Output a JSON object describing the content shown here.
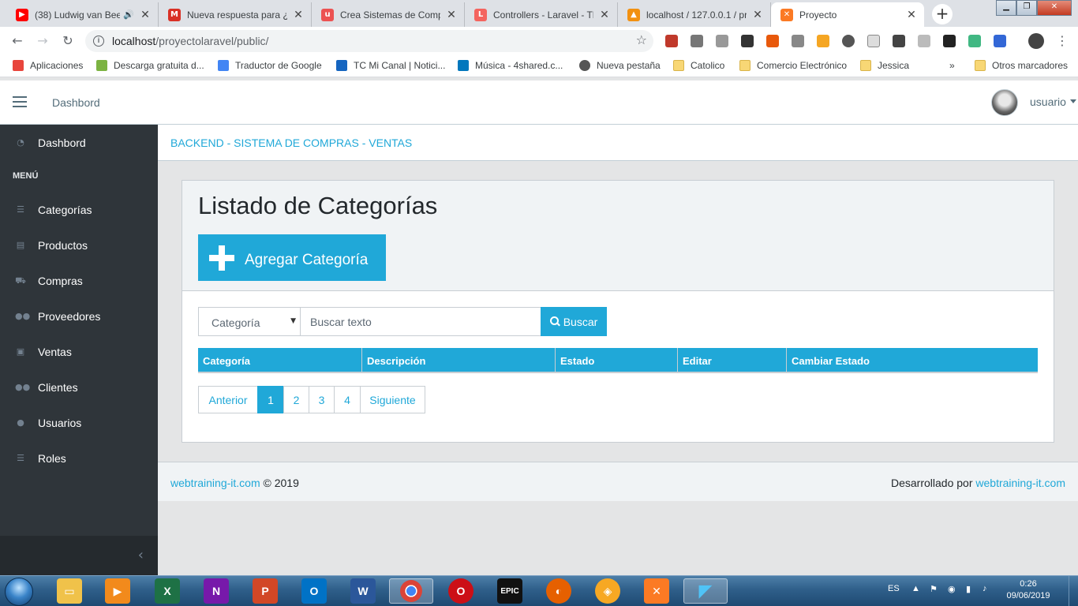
{
  "browser": {
    "tabs": [
      {
        "title": "(38) Ludwig van Bee",
        "fav": "youtube-icon",
        "color": "#ff0000",
        "glyph": "▶"
      },
      {
        "title": "Nueva respuesta para ¿C",
        "fav": "gmail-icon",
        "color": "#d93025",
        "glyph": "M"
      },
      {
        "title": "Crea Sistemas de Compr",
        "fav": "udemy-icon",
        "color": "#ec5252",
        "glyph": "u"
      },
      {
        "title": "Controllers - Laravel - Th",
        "fav": "laravel-icon",
        "color": "#f4645f",
        "glyph": "L"
      },
      {
        "title": "localhost / 127.0.0.1 / pr",
        "fav": "phpmyadmin-icon",
        "color": "#f29111",
        "glyph": "▲"
      },
      {
        "title": "Proyecto",
        "fav": "xampp-icon",
        "color": "#fb7a24",
        "glyph": "✕"
      }
    ],
    "address": {
      "host": "localhost",
      "path": "/proyectolaravel/public/"
    },
    "bookmarks": [
      {
        "label": "Aplicaciones",
        "icon": "apps-grid-icon",
        "folder": false,
        "color": "#e8453c"
      },
      {
        "label": "Descarga gratuita d...",
        "icon": "download-icon",
        "folder": false,
        "color": "#7cb342"
      },
      {
        "label": "Traductor de Google",
        "icon": "google-translate-icon",
        "folder": false,
        "color": "#4285f4"
      },
      {
        "label": "TC Mi Canal | Notici...",
        "icon": "tc-icon",
        "folder": false,
        "color": "#1565c0"
      },
      {
        "label": "Música - 4shared.c...",
        "icon": "4shared-icon",
        "folder": false,
        "color": "#0277bd"
      },
      {
        "label": "Nueva pestaña",
        "icon": "globe-icon",
        "folder": false,
        "color": "#555555"
      },
      {
        "label": "Catolico",
        "icon": "folder-icon",
        "folder": true
      },
      {
        "label": "Comercio Electrónico",
        "icon": "folder-icon",
        "folder": true
      },
      {
        "label": "Jessica",
        "icon": "folder-icon",
        "folder": true
      },
      {
        "label": "»",
        "icon": "chevron-more-icon",
        "folder": false,
        "color": ""
      },
      {
        "label": "Otros marcadores",
        "icon": "folder-icon",
        "folder": true
      }
    ]
  },
  "header": {
    "dashboard_link": "Dashbord",
    "user": "usuario"
  },
  "sidebar": {
    "dashboard": "Dashbord",
    "section_title": "MENÚ",
    "items": [
      {
        "label": "Categorías",
        "icon": "list-icon",
        "glyph": "☰"
      },
      {
        "label": "Productos",
        "icon": "product-icon",
        "glyph": "▤"
      },
      {
        "label": "Compras",
        "icon": "cart-icon",
        "glyph": "⛟"
      },
      {
        "label": "Proveedores",
        "icon": "users-icon",
        "glyph": "👥"
      },
      {
        "label": "Ventas",
        "icon": "briefcase-icon",
        "glyph": "▣"
      },
      {
        "label": "Clientes",
        "icon": "users-icon",
        "glyph": "👥"
      },
      {
        "label": "Usuarios",
        "icon": "user-icon",
        "glyph": "👤"
      },
      {
        "label": "Roles",
        "icon": "list-icon",
        "glyph": "☰"
      }
    ]
  },
  "breadcrumb": "BACKEND - SISTEMA DE COMPRAS - VENTAS",
  "main": {
    "title": "Listado de Categorías",
    "add_button": "Agregar Categoría",
    "filter_select": "Categoría",
    "search_placeholder": "Buscar texto",
    "search_button": "Buscar",
    "table_headers": [
      "Categoría",
      "Descripción",
      "Estado",
      "Editar",
      "Cambiar Estado"
    ],
    "pagination": {
      "prev": "Anterior",
      "pages": [
        "1",
        "2",
        "3",
        "4"
      ],
      "active": "1",
      "next": "Siguiente"
    }
  },
  "footer": {
    "left_link": "webtraining-it.com",
    "left_text": "© 2019",
    "right_text": "Desarrollado por",
    "right_link": "webtraining-it.com"
  },
  "taskbar": {
    "apps": [
      {
        "name": "explorer-icon",
        "color": "#f0c24a",
        "glyph": "▭"
      },
      {
        "name": "media-player-icon",
        "color": "#f28a1c",
        "glyph": "▶"
      },
      {
        "name": "excel-icon",
        "color": "#1e7145",
        "glyph": "X"
      },
      {
        "name": "onenote-icon",
        "color": "#7719aa",
        "glyph": "N"
      },
      {
        "name": "powerpoint-icon",
        "color": "#d24726",
        "glyph": "P"
      },
      {
        "name": "outlook-icon",
        "color": "#0072c6",
        "glyph": "O"
      },
      {
        "name": "word-icon",
        "color": "#2b579a",
        "glyph": "W"
      },
      {
        "name": "chrome-icon",
        "color": "#db4437",
        "glyph": "◉"
      },
      {
        "name": "opera-icon",
        "color": "#cc0f16",
        "glyph": "O"
      },
      {
        "name": "epic-games-icon",
        "color": "#111111",
        "glyph": "E"
      },
      {
        "name": "firefox-icon",
        "color": "#e66000",
        "glyph": "◐"
      },
      {
        "name": "avast-browser-icon",
        "color": "#f7a823",
        "glyph": "◈"
      },
      {
        "name": "xampp-icon",
        "color": "#fb7a24",
        "glyph": "✕"
      },
      {
        "name": "vscode-icon",
        "color": "#0078d7",
        "glyph": "◤"
      }
    ],
    "lang": "ES",
    "time": "0:26",
    "date": "09/06/2019"
  }
}
